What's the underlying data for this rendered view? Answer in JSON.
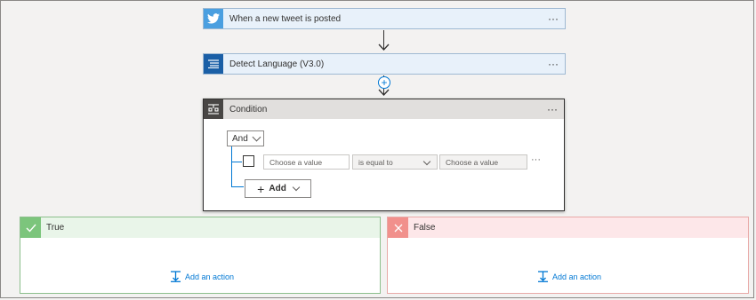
{
  "flow": {
    "trigger": {
      "title": "When a new tweet is posted",
      "more": "···",
      "icon": "twitter-bird-icon"
    },
    "action": {
      "title": "Detect Language (V3.0)",
      "more": "···",
      "icon": "text-lines-icon"
    },
    "insert_step": "+",
    "condition": {
      "title": "Condition",
      "more": "···",
      "icon": "condition-icon",
      "group_operator": "And",
      "row": {
        "left_placeholder": "Choose a value",
        "operator": "is equal to",
        "right_placeholder": "Choose a value",
        "more": "···"
      },
      "add_label": "Add"
    },
    "branches": {
      "true": {
        "title": "True",
        "add_action": "Add an action"
      },
      "false": {
        "title": "False",
        "add_action": "Add an action"
      }
    }
  },
  "colors": {
    "twitter_blue": "#4a9fe0",
    "action_blue": "#1a5fa6",
    "link_blue": "#0078d4",
    "true_green": "#7cc57c",
    "false_red": "#f1908c"
  }
}
